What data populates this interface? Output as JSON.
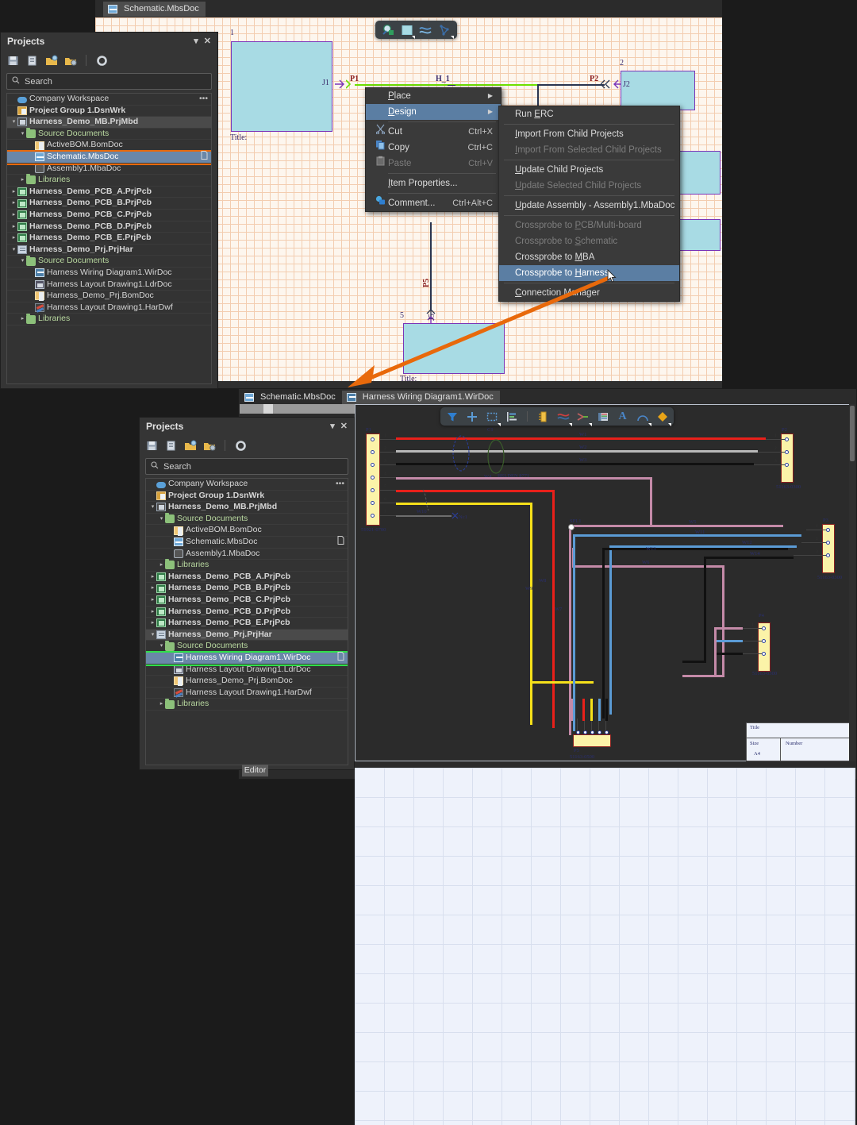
{
  "app": {
    "top_tab": "Schematic.MbsDoc",
    "editor_button": "Editor"
  },
  "projects_panel_top": {
    "title": "Projects",
    "collapse_icon": "chevron-down-icon",
    "close_icon": "close-icon",
    "toolbar": [
      {
        "name": "save-icon",
        "glyph": "save"
      },
      {
        "name": "compile-icon",
        "glyph": "compile"
      },
      {
        "name": "open-project-icon",
        "glyph": "open-project"
      },
      {
        "name": "add-project-icon",
        "glyph": "add-project"
      },
      {
        "name": "settings-gear-icon",
        "glyph": "gear"
      }
    ],
    "search": {
      "placeholder": "Search",
      "value": "",
      "icon": "search-icon"
    },
    "tree": [
      {
        "label": "Company Workspace",
        "depth": 0,
        "icon": "cloud-icon",
        "arrow": "",
        "more": "•••",
        "state": ""
      },
      {
        "label": "Project Group 1.DsnWrk",
        "depth": 0,
        "icon": "project-group-icon",
        "arrow": "",
        "state": ""
      },
      {
        "label": "Harness_Demo_MB.PrjMbd",
        "depth": 0,
        "icon": "multiboard-project-icon",
        "arrow": "▾",
        "state": "selected-grey"
      },
      {
        "label": "Source Documents",
        "depth": 1,
        "icon": "folder-icon",
        "arrow": "▾",
        "state": ""
      },
      {
        "label": "ActiveBOM.BomDoc",
        "depth": 2,
        "icon": "bom-icon",
        "arrow": "",
        "state": ""
      },
      {
        "label": "Schematic.MbsDoc",
        "depth": 2,
        "icon": "schematic-icon",
        "arrow": "",
        "state": "selected-blue-highlight",
        "page_icon": "document-page-icon"
      },
      {
        "label": "Assembly1.MbaDoc",
        "depth": 2,
        "icon": "assembly-icon",
        "arrow": "",
        "state": ""
      },
      {
        "label": "Libraries",
        "depth": 1,
        "icon": "folder-icon",
        "arrow": "▸",
        "state": ""
      },
      {
        "label": "Harness_Demo_PCB_A.PrjPcb",
        "depth": 0,
        "icon": "pcb-project-icon",
        "arrow": "▸",
        "state": ""
      },
      {
        "label": "Harness_Demo_PCB_B.PrjPcb",
        "depth": 0,
        "icon": "pcb-project-icon",
        "arrow": "▸",
        "state": ""
      },
      {
        "label": "Harness_Demo_PCB_C.PrjPcb",
        "depth": 0,
        "icon": "pcb-project-icon",
        "arrow": "▸",
        "state": ""
      },
      {
        "label": "Harness_Demo_PCB_D.PrjPcb",
        "depth": 0,
        "icon": "pcb-project-icon",
        "arrow": "▸",
        "state": ""
      },
      {
        "label": "Harness_Demo_PCB_E.PrjPcb",
        "depth": 0,
        "icon": "pcb-project-icon",
        "arrow": "▸",
        "state": ""
      },
      {
        "label": "Harness_Demo_Prj.PrjHar",
        "depth": 0,
        "icon": "harness-project-icon",
        "arrow": "▾",
        "state": ""
      },
      {
        "label": "Source Documents",
        "depth": 1,
        "icon": "folder-icon",
        "arrow": "▾",
        "state": ""
      },
      {
        "label": "Harness Wiring Diagram1.WirDoc",
        "depth": 2,
        "icon": "wiring-diagram-icon",
        "arrow": "",
        "state": ""
      },
      {
        "label": "Harness Layout Drawing1.LdrDoc",
        "depth": 2,
        "icon": "layout-drawing-icon",
        "arrow": "",
        "state": ""
      },
      {
        "label": "Harness_Demo_Prj.BomDoc",
        "depth": 2,
        "icon": "bom-icon",
        "arrow": "",
        "state": ""
      },
      {
        "label": "Harness Layout Drawing1.HarDwf",
        "depth": 2,
        "icon": "harness-drawing-icon",
        "arrow": "",
        "state": ""
      },
      {
        "label": "Libraries",
        "depth": 1,
        "icon": "folder-icon",
        "arrow": "▸",
        "state": ""
      }
    ]
  },
  "projects_panel_bottom": {
    "title": "Projects",
    "search": {
      "placeholder": "Search",
      "value": ""
    },
    "tree": [
      {
        "label": "Company Workspace",
        "depth": 0,
        "icon": "cloud-icon",
        "arrow": "",
        "more": "•••",
        "state": ""
      },
      {
        "label": "Project Group 1.DsnWrk",
        "depth": 0,
        "icon": "project-group-icon",
        "arrow": "",
        "state": ""
      },
      {
        "label": "Harness_Demo_MB.PrjMbd",
        "depth": 0,
        "icon": "multiboard-project-icon",
        "arrow": "▾",
        "state": ""
      },
      {
        "label": "Source Documents",
        "depth": 1,
        "icon": "folder-icon",
        "arrow": "▾",
        "state": ""
      },
      {
        "label": "ActiveBOM.BomDoc",
        "depth": 2,
        "icon": "bom-icon",
        "arrow": "",
        "state": ""
      },
      {
        "label": "Schematic.MbsDoc",
        "depth": 2,
        "icon": "schematic-icon",
        "arrow": "",
        "state": "",
        "page_icon": "document-page-icon"
      },
      {
        "label": "Assembly1.MbaDoc",
        "depth": 2,
        "icon": "assembly-icon",
        "arrow": "",
        "state": ""
      },
      {
        "label": "Libraries",
        "depth": 1,
        "icon": "folder-icon",
        "arrow": "▸",
        "state": ""
      },
      {
        "label": "Harness_Demo_PCB_A.PrjPcb",
        "depth": 0,
        "icon": "pcb-project-icon",
        "arrow": "▸",
        "state": ""
      },
      {
        "label": "Harness_Demo_PCB_B.PrjPcb",
        "depth": 0,
        "icon": "pcb-project-icon",
        "arrow": "▸",
        "state": ""
      },
      {
        "label": "Harness_Demo_PCB_C.PrjPcb",
        "depth": 0,
        "icon": "pcb-project-icon",
        "arrow": "▸",
        "state": ""
      },
      {
        "label": "Harness_Demo_PCB_D.PrjPcb",
        "depth": 0,
        "icon": "pcb-project-icon",
        "arrow": "▸",
        "state": ""
      },
      {
        "label": "Harness_Demo_PCB_E.PrjPcb",
        "depth": 0,
        "icon": "pcb-project-icon",
        "arrow": "▸",
        "state": ""
      },
      {
        "label": "Harness_Demo_Prj.PrjHar",
        "depth": 0,
        "icon": "harness-project-icon",
        "arrow": "▾",
        "state": "selected-grey"
      },
      {
        "label": "Source Documents",
        "depth": 1,
        "icon": "folder-icon",
        "arrow": "▾",
        "state": ""
      },
      {
        "label": "Harness Wiring Diagram1.WirDoc",
        "depth": 2,
        "icon": "wiring-diagram-icon",
        "arrow": "",
        "state": "selected-blue-green",
        "page_icon": "document-page-icon"
      },
      {
        "label": "Harness Layout Drawing1.LdrDoc",
        "depth": 2,
        "icon": "layout-drawing-icon",
        "arrow": "",
        "state": ""
      },
      {
        "label": "Harness_Demo_Prj.BomDoc",
        "depth": 2,
        "icon": "bom-icon",
        "arrow": "",
        "state": ""
      },
      {
        "label": "Harness Layout Drawing1.HarDwf",
        "depth": 2,
        "icon": "harness-drawing-icon",
        "arrow": "",
        "state": ""
      },
      {
        "label": "Libraries",
        "depth": 1,
        "icon": "folder-icon",
        "arrow": "▸",
        "state": ""
      }
    ]
  },
  "context_menu": {
    "items": [
      {
        "label": "Place",
        "accel": "P",
        "submenu": true,
        "disabled": false,
        "hover": false,
        "icon": ""
      },
      {
        "label": "Design",
        "accel": "D",
        "submenu": true,
        "disabled": false,
        "hover": true,
        "icon": ""
      },
      {
        "sep": true
      },
      {
        "label": "Cut",
        "shortcut": "Ctrl+X",
        "disabled": false,
        "icon": "cut-icon"
      },
      {
        "label": "Copy",
        "shortcut": "Ctrl+C",
        "disabled": false,
        "icon": "copy-icon"
      },
      {
        "label": "Paste",
        "shortcut": "Ctrl+V",
        "disabled": true,
        "icon": "paste-icon"
      },
      {
        "sep": true
      },
      {
        "label": "Item Properties...",
        "accel": "I",
        "disabled": false,
        "icon": ""
      },
      {
        "sep": true
      },
      {
        "label": "Comment...",
        "shortcut": "Ctrl+Alt+C",
        "disabled": false,
        "icon": "comment-icon"
      }
    ]
  },
  "design_submenu": {
    "items": [
      {
        "label": "Run ERC",
        "accel": "E",
        "disabled": false
      },
      {
        "sep": true
      },
      {
        "label": "Import From Child Projects",
        "accel": "I",
        "disabled": false
      },
      {
        "label": "Import From Selected Child Projects",
        "accel": "I",
        "disabled": true
      },
      {
        "sep": true
      },
      {
        "label": "Update Child Projects",
        "accel": "U",
        "disabled": false
      },
      {
        "label": "Update Selected Child Projects",
        "accel": "U",
        "disabled": true
      },
      {
        "sep": true
      },
      {
        "label": "Update Assembly - Assembly1.MbaDoc",
        "accel": "U",
        "disabled": false
      },
      {
        "sep": true
      },
      {
        "label": "Crossprobe to PCB/Multi-board",
        "accel": "P",
        "disabled": true
      },
      {
        "label": "Crossprobe to Schematic",
        "accel": "S",
        "disabled": true
      },
      {
        "label": "Crossprobe to MBA",
        "accel": "M",
        "disabled": false
      },
      {
        "label": "Crossprobe to Harness",
        "accel": "H",
        "disabled": false,
        "hover": true
      },
      {
        "sep": true
      },
      {
        "label": "Connection Manager",
        "accel": "C",
        "disabled": false
      }
    ]
  },
  "schematic": {
    "floating_toolbar": [
      {
        "name": "crossprobe-icon"
      },
      {
        "name": "block-icon"
      },
      {
        "name": "wire-icon"
      },
      {
        "name": "harness-icon"
      }
    ],
    "blocks": [
      {
        "designator": "J1",
        "number": "1",
        "title": "Title:"
      },
      {
        "designator": "J2",
        "number": "2",
        "title": ""
      },
      {
        "designator": "J5",
        "number": "5",
        "title": "Title:"
      }
    ],
    "ports": [
      "P1",
      "P2",
      "P5"
    ],
    "harness_net": "H_1"
  },
  "wiring_tabs": [
    {
      "label": "Schematic.MbsDoc",
      "icon": "schematic-icon",
      "active": false
    },
    {
      "label": "Harness Wiring Diagram1.WirDoc",
      "icon": "wiring-diagram-icon",
      "active": true
    }
  ],
  "wiring_toolbar": [
    {
      "name": "filter-icon"
    },
    {
      "name": "add-icon"
    },
    {
      "name": "select-area-icon"
    },
    {
      "name": "align-icon"
    },
    {
      "name": "connector-icon"
    },
    {
      "name": "wire-icon"
    },
    {
      "name": "splice-icon"
    },
    {
      "name": "table-icon"
    },
    {
      "name": "text-icon"
    },
    {
      "name": "arc-icon"
    },
    {
      "name": "shape-icon"
    }
  ],
  "wiring_diagram": {
    "connectors": [
      {
        "ref": "P1",
        "part": "51021-0700",
        "pins": [
          "1",
          "2",
          "3",
          "4",
          "5",
          "6",
          "7"
        ]
      },
      {
        "ref": "P2",
        "part": "51163-0300",
        "pins": [
          "1",
          "2",
          "3"
        ]
      },
      {
        "ref": "P3",
        "part": "51163-0300",
        "pins": [
          "1",
          "2",
          "3"
        ]
      },
      {
        "ref": "P4",
        "part": "51163-0300",
        "pins": [
          "1",
          "2",
          "3"
        ]
      },
      {
        "ref": "P5",
        "part": "51163-0500",
        "pins": [
          "1",
          "2",
          "3",
          "4",
          "5"
        ]
      }
    ],
    "cable": {
      "ref": "C1",
      "part": "BELDEN 8771"
    },
    "splice": {
      "ref": "SPL1"
    },
    "shield": {
      "ref": "W4"
    },
    "no_connect": {
      "label": "Nc1",
      "wire": "W10"
    },
    "wires": [
      "W1",
      "W2",
      "W3",
      "W4",
      "W5",
      "W6",
      "W7",
      "W8",
      "W9",
      "W10",
      "W11",
      "W12",
      "W13",
      "W14"
    ],
    "title_block": {
      "title": "Title",
      "size_label": "Size",
      "size_value": "A4",
      "number_label": "Number"
    }
  }
}
